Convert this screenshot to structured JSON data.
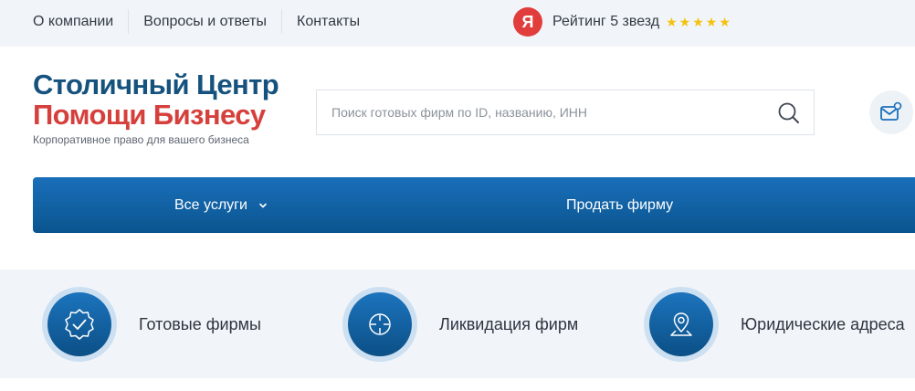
{
  "topnav": {
    "items": [
      {
        "label": "О компании"
      },
      {
        "label": "Вопросы и ответы"
      },
      {
        "label": "Контакты"
      }
    ]
  },
  "rating": {
    "badge": "Я",
    "text": "Рейтинг 5 звезд",
    "stars": 5,
    "star_color": "#f4c20d"
  },
  "logo": {
    "line1": "Столичный Центр",
    "line2": "Помощи Бизнесу",
    "tagline": "Корпоративное право для вашего бизнеса",
    "color_line1": "#16527e",
    "color_line2": "#d6403c"
  },
  "search": {
    "value": "",
    "placeholder": "Поиск готовых фирм по ID, названию, ИНН",
    "icon": "search-icon"
  },
  "header_actions": {
    "mail_icon": "mail-icon"
  },
  "menu": {
    "services_label": "Все услуги",
    "sell_label": "Продать фирму",
    "accent": "#1a6fba"
  },
  "services": [
    {
      "label": "Готовые фирмы",
      "icon": "check-badge-icon"
    },
    {
      "label": "Ликвидация фирм",
      "icon": "crosshair-icon"
    },
    {
      "label": "Юридические адреса",
      "icon": "location-pin-icon"
    }
  ]
}
